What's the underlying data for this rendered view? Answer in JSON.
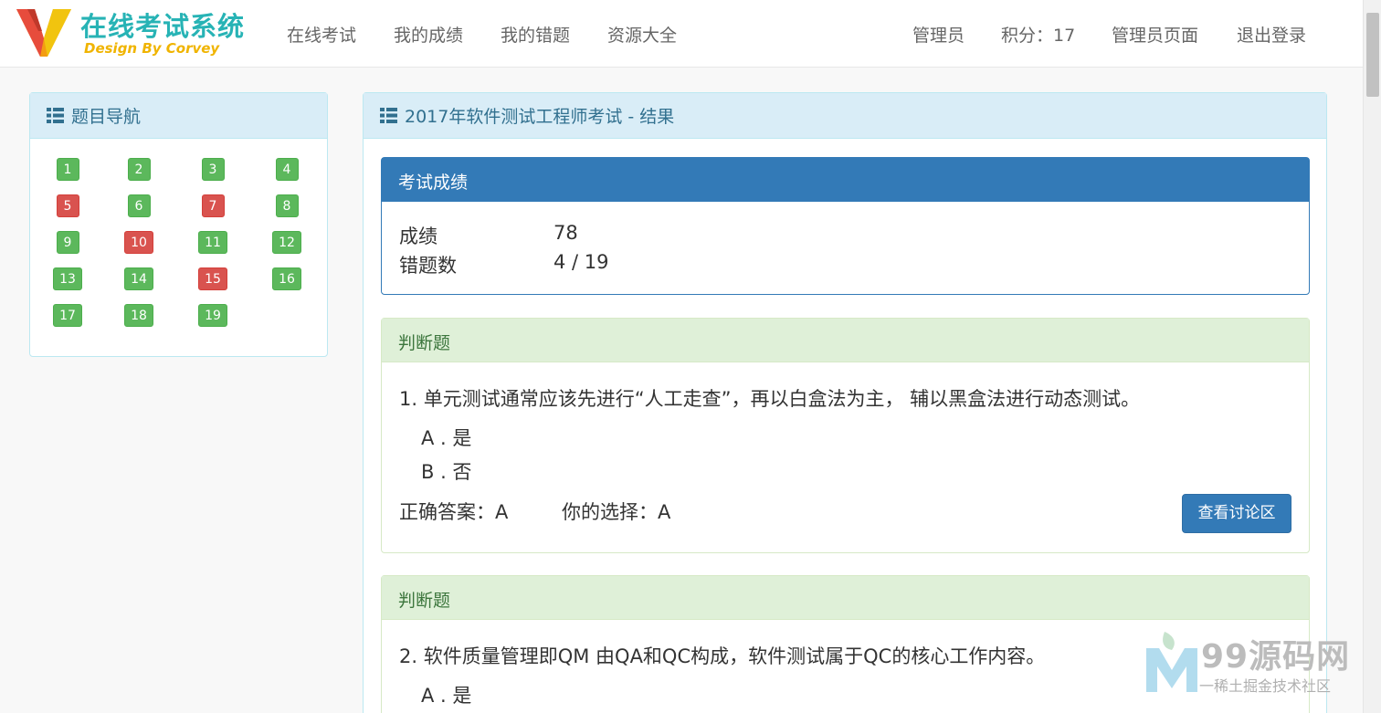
{
  "brand": {
    "title": "在线考试系统",
    "subtitle": "Design By Corvey"
  },
  "nav": {
    "left": [
      "在线考试",
      "我的成绩",
      "我的错题",
      "资源大全"
    ],
    "user": "管理员",
    "points": "积分：17",
    "admin_page": "管理员页面",
    "logout": "退出登录"
  },
  "question_nav": {
    "title": "题目导航",
    "items": [
      {
        "label": "1",
        "status": "correct"
      },
      {
        "label": "2",
        "status": "correct"
      },
      {
        "label": "3",
        "status": "correct"
      },
      {
        "label": "4",
        "status": "correct"
      },
      {
        "label": "5",
        "status": "wrong"
      },
      {
        "label": "6",
        "status": "correct"
      },
      {
        "label": "7",
        "status": "wrong"
      },
      {
        "label": "8",
        "status": "correct"
      },
      {
        "label": "9",
        "status": "correct"
      },
      {
        "label": "10",
        "status": "wrong"
      },
      {
        "label": "11",
        "status": "correct"
      },
      {
        "label": "12",
        "status": "correct"
      },
      {
        "label": "13",
        "status": "correct"
      },
      {
        "label": "14",
        "status": "correct"
      },
      {
        "label": "15",
        "status": "wrong"
      },
      {
        "label": "16",
        "status": "correct"
      },
      {
        "label": "17",
        "status": "correct"
      },
      {
        "label": "18",
        "status": "correct"
      },
      {
        "label": "19",
        "status": "correct"
      }
    ]
  },
  "main": {
    "title": "2017年软件测试工程师考试 - 结果",
    "score": {
      "heading": "考试成绩",
      "score_label": "成绩",
      "score_value": "78",
      "wrong_label": "错题数",
      "wrong_value": "4 / 19"
    },
    "questions": [
      {
        "type": "判断题",
        "text": "1. 单元测试通常应该先进行“人工走查”，再以白盒法为主， 辅以黑盒法进行动态测试。",
        "options": [
          "A . 是",
          "B . 否"
        ],
        "correct": "正确答案：A",
        "yours": "你的选择：A",
        "discuss": "查看讨论区"
      },
      {
        "type": "判断题",
        "text": "2. 软件质量管理即QM 由QA和QC构成，软件测试属于QC的核心工作内容。",
        "options": [
          "A . 是"
        ]
      }
    ]
  },
  "watermark": {
    "title": "99源码网",
    "sub": "一稀土掘金技术社区"
  },
  "colors": {
    "correct": "#5cb85c",
    "wrong": "#d9534f",
    "primary": "#337ab7",
    "info_bg": "#d9edf7",
    "success_bg": "#dff0d8"
  }
}
